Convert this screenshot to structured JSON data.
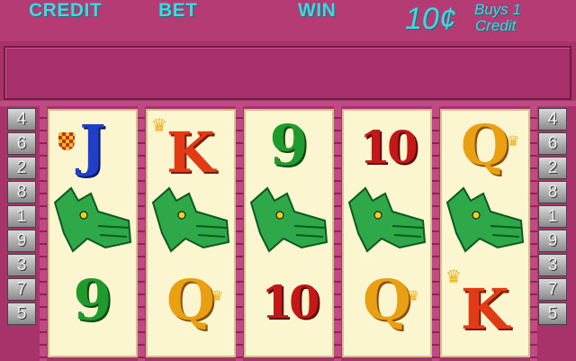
{
  "header": {
    "credit_label": "CREDIT",
    "bet_label": "BET",
    "win_label": "WIN",
    "denomination": "10¢",
    "buys_line1": "Buys 1",
    "buys_line2": "Credit"
  },
  "line_indicators": {
    "left": [
      "4",
      "6",
      "2",
      "8",
      "1",
      "9",
      "3",
      "7",
      "5"
    ],
    "right": [
      "4",
      "6",
      "2",
      "8",
      "1",
      "9",
      "3",
      "7",
      "5"
    ]
  },
  "reels": [
    {
      "top": "J",
      "middle": "dragon",
      "bottom": "9"
    },
    {
      "top": "K",
      "middle": "dragon",
      "bottom": "Q"
    },
    {
      "top": "9",
      "middle": "dragon",
      "bottom": "10"
    },
    {
      "top": "10",
      "middle": "dragon",
      "bottom": "Q"
    },
    {
      "top": "Q",
      "middle": "dragon",
      "bottom": "K"
    }
  ],
  "colors": {
    "background": "#a8326a",
    "header_text": "#3fd8df",
    "reel_bg": "#fbf6d0",
    "jack_blue": "#1f3fc4",
    "green": "#1f9a2c",
    "red": "#c41818",
    "gold": "#e8a012"
  }
}
